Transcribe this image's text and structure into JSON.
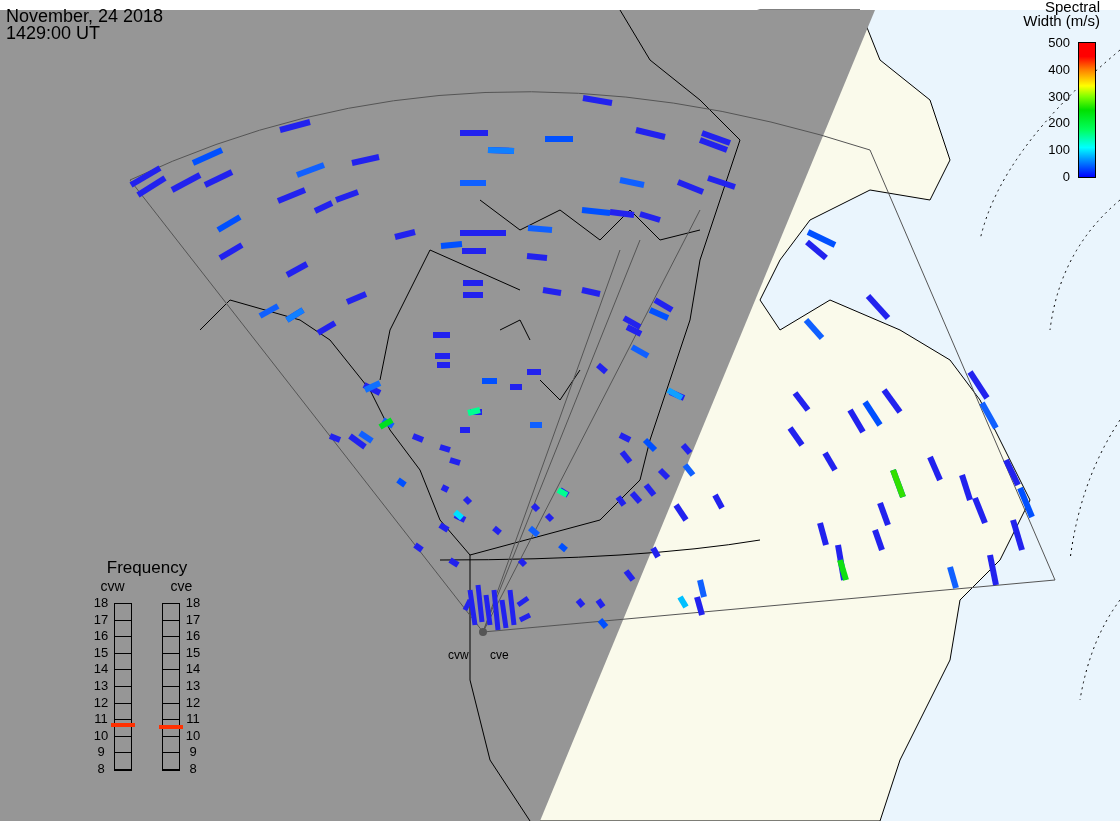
{
  "header": {
    "date": "November, 24 2018",
    "time": "1429:00 UT"
  },
  "colorbar": {
    "title": [
      "Spectral",
      "Width (m/s)"
    ],
    "ticks": [
      "500",
      "400",
      "300",
      "200",
      "100",
      "0"
    ]
  },
  "frequency": {
    "title": "Frequency",
    "radars": [
      {
        "name": "cvw",
        "level": 0.27,
        "ticks": [
          "18",
          "17",
          "16",
          "15",
          "14",
          "13",
          "12",
          "11",
          "10",
          "9",
          "8"
        ]
      },
      {
        "name": "cve",
        "level": 0.26,
        "ticks": [
          "18",
          "17",
          "16",
          "15",
          "14",
          "13",
          "12",
          "11",
          "10",
          "9",
          "8"
        ]
      }
    ]
  },
  "sites": [
    "cvw",
    "cve"
  ]
}
